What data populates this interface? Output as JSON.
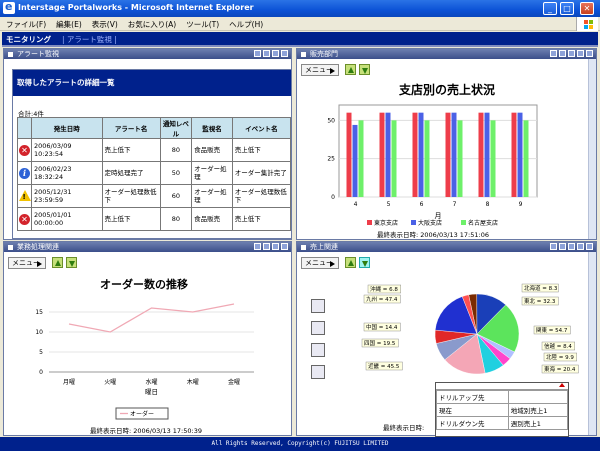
{
  "window": {
    "title": "Interstage Portalworks - Microsoft Internet Explorer",
    "min": "_",
    "max": "□",
    "close": "✕"
  },
  "menu": [
    "ファイル(F)",
    "編集(E)",
    "表示(V)",
    "お気に入り(A)",
    "ツール(T)",
    "ヘルプ(H)"
  ],
  "header": {
    "title": "モニタリング",
    "sub": "| アラート監視 |"
  },
  "panels": {
    "alert": {
      "title": "アラート監視"
    },
    "sales": {
      "title": "販売部門"
    },
    "business": {
      "title": "業務処理関連"
    },
    "uriage": {
      "title": "売上関連"
    }
  },
  "alert_box": {
    "heading": "取得したアラートの詳細一覧",
    "count": "合計:4件",
    "columns": [
      "発生日時",
      "アラート名",
      "通知レベル",
      "監視名",
      "イベント名"
    ],
    "rows": [
      {
        "icon": "error-icon",
        "kind": "err",
        "date": "2006/03/09 10:23:54",
        "name": "売上低下",
        "level": "80",
        "monitor": "食品販売",
        "event": "売上低下"
      },
      {
        "icon": "info-icon",
        "kind": "info",
        "date": "2006/02/23 18:32:24",
        "name": "定時処理完了",
        "level": "50",
        "monitor": "オーダー処理",
        "event": "オーダー集計完了"
      },
      {
        "icon": "warning-icon",
        "kind": "warn",
        "date": "2005/12/31 23:59:59",
        "name": "オーダー処理数低下",
        "level": "60",
        "monitor": "オーダー処理",
        "event": "オーダー処理数低下"
      },
      {
        "icon": "error-icon",
        "kind": "err",
        "date": "2005/01/01 00:00:00",
        "name": "売上低下",
        "level": "80",
        "monitor": "食品販売",
        "event": "売上低下"
      }
    ]
  },
  "menu_button": "メニュー",
  "sales_chart_footer": "最終表示日時: 2006/03/13 17:51:06",
  "orders_chart_footer": "最終表示日時: 2006/03/13 17:50:39",
  "uriage_footer": "最終表示日時:",
  "footer": "All Rights Reserved, Copyright(c) FUJITSU LIMITED",
  "popup": {
    "rows": [
      {
        "label": "ドリルアップ先",
        "value": ""
      },
      {
        "label": "現在",
        "value": "地域別売上1"
      },
      {
        "label": "ドリルダウン先",
        "value": "週別売上1"
      }
    ]
  },
  "colors": {
    "tokyo": "#ee3d4a",
    "osaka": "#4b61e6",
    "nagoya": "#6ef06a",
    "line": "#f0a8b4"
  },
  "chart_data": [
    {
      "type": "bar",
      "title": "支店別の売上状況",
      "xlabel": "月",
      "ylabel": "",
      "categories": [
        "4",
        "5",
        "6",
        "7",
        "8",
        "9"
      ],
      "ylim": [
        0,
        60
      ],
      "yticks": [
        0,
        25,
        50
      ],
      "series": [
        {
          "name": "東京支店",
          "values": [
            55,
            55,
            55,
            55,
            55,
            55
          ]
        },
        {
          "name": "大阪支店",
          "values": [
            47,
            55,
            55,
            55,
            55,
            55
          ]
        },
        {
          "name": "名古屋支店",
          "values": [
            50,
            50,
            50,
            50,
            50,
            50
          ]
        }
      ]
    },
    {
      "type": "line",
      "title": "オーダー数の推移",
      "xlabel": "曜日",
      "ylabel": "",
      "categories": [
        "月曜",
        "火曜",
        "水曜",
        "木曜",
        "金曜"
      ],
      "ylim": [
        0,
        18
      ],
      "yticks": [
        0,
        5,
        10,
        15
      ],
      "series": [
        {
          "name": "オーダー",
          "values": [
            12,
            10,
            16,
            15,
            17
          ]
        }
      ]
    },
    {
      "type": "pie",
      "labels": [
        "北海道",
        "東北",
        "関東",
        "信越",
        "北陸",
        "東海",
        "近畿",
        "四国",
        "中国",
        "九州",
        "沖縄"
      ],
      "values": [
        8.3,
        32.3,
        54.7,
        8.4,
        9.9,
        20.4,
        45.5,
        19.5,
        14.4,
        47.4,
        6.8
      ],
      "display": [
        "北海道 = 8.3",
        "東北 = 32.3",
        "関東 = 54.7",
        "信越 = 8.4",
        "北陸 = 9.9",
        "東海 = 20.4",
        "近畿 = 45.5",
        "四国 = 19.5",
        "中国 = 14.4",
        "九州 = 47.4",
        "沖縄 = 6.8"
      ],
      "colors": [
        "#7b2b00",
        "#1a3fb8",
        "#5ce45c",
        "#b0c0ff",
        "#ff44cc",
        "#20d0e0",
        "#f4a6b6",
        "#8a9acc",
        "#e02828",
        "#2030d0",
        "#ff5050"
      ]
    }
  ]
}
